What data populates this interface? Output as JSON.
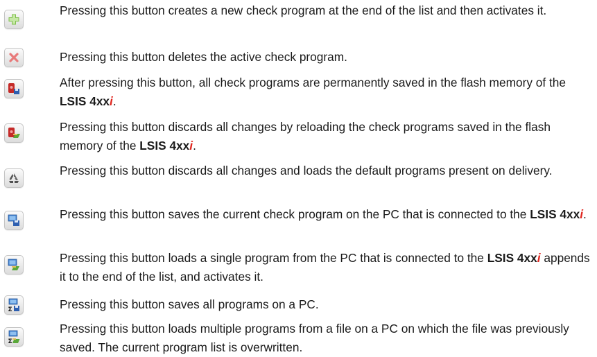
{
  "product": {
    "name": "LSIS 4xx",
    "suffix": "i"
  },
  "items": [
    {
      "icon": "add-program-icon",
      "text": "Pressing this button creates a new check program at the end of the list and then activates it."
    },
    {
      "icon": "delete-program-icon",
      "text": "Pressing this button deletes the active check program."
    },
    {
      "icon": "save-to-flash-icon",
      "text_a": "After pressing this button, all check programs are permanently saved in the flash memory of the ",
      "text_b": "."
    },
    {
      "icon": "reload-from-flash-icon",
      "text_a": "Pressing this button discards all changes by reloading the check programs saved in the flash memory of the ",
      "text_b": "."
    },
    {
      "icon": "load-defaults-icon",
      "text": "Pressing this button discards all changes and loads the default programs present on delivery."
    },
    {
      "icon": "save-program-to-pc-icon",
      "text_a": "Pressing this button saves the current check program on the PC that is connected to the ",
      "text_b": "."
    },
    {
      "icon": "load-program-from-pc-icon",
      "text_a": "Pressing this button loads a single program from the PC that is connected to the ",
      "text_b": " appends it to the end of the list, and activates it."
    },
    {
      "icon": "save-all-to-pc-icon",
      "text": "Pressing this button saves all programs on a PC."
    },
    {
      "icon": "load-all-from-pc-icon",
      "text": "Pressing this button loads multiple programs from a file on a PC on which the file was previously saved. The current program list is overwritten."
    }
  ]
}
